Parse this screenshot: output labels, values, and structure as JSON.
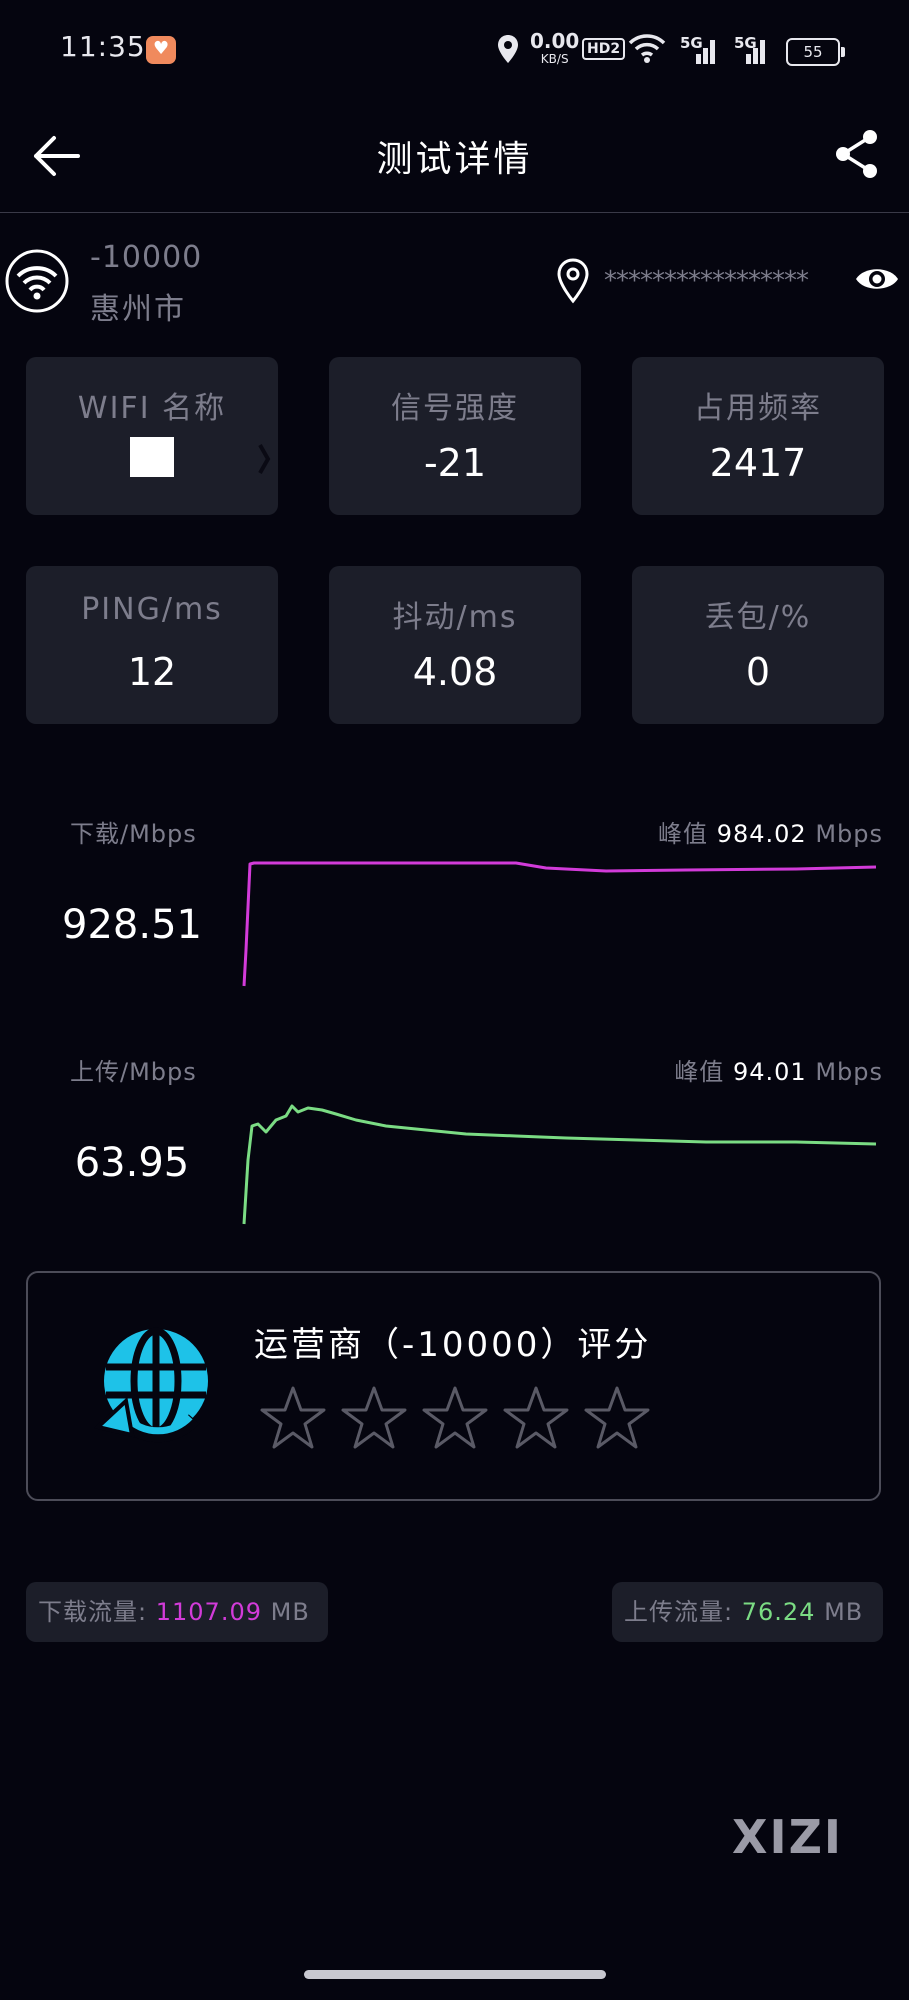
{
  "status_bar": {
    "time": "11:35",
    "net_speed": "0.00",
    "net_unit": "KB/S",
    "hd_badge": "HD2",
    "signal_1": "5G",
    "signal_2": "5G",
    "battery": "55"
  },
  "header": {
    "title": "测试详情",
    "back_icon": "arrow-left-icon",
    "share_icon": "share-icon"
  },
  "info": {
    "isp": "-10000",
    "city": "惠州市",
    "masked_address": "*****************",
    "wifi_icon": "wifi-icon",
    "location_icon": "location-pin-icon",
    "reveal_icon": "eye-icon"
  },
  "stats": [
    {
      "label": "WIFI 名称",
      "value": ""
    },
    {
      "label": "信号强度",
      "value": "-21"
    },
    {
      "label": "占用频率",
      "value": "2417"
    },
    {
      "label": "PING/ms",
      "value": "12"
    },
    {
      "label": "抖动/ms",
      "value": "4.08"
    },
    {
      "label": "丢包/%",
      "value": "0"
    }
  ],
  "download": {
    "label": "下载/Mbps",
    "peak_label": "峰值",
    "peak_value": "984.02",
    "peak_unit": "Mbps",
    "value": "928.51",
    "color": "#d23bd9"
  },
  "upload": {
    "label": "上传/Mbps",
    "peak_label": "峰值",
    "peak_value": "94.01",
    "peak_unit": "Mbps",
    "value": "63.95",
    "color": "#7bdc84"
  },
  "rating": {
    "title": "运营商（-10000）评分",
    "stars": 5,
    "filled": 0,
    "icon": "globe-refresh-icon",
    "icon_color": "#1ec2e8"
  },
  "traffic": {
    "download_label": "下载流量:",
    "download_value": "1107.09",
    "download_unit": "MB",
    "upload_label": "上传流量:",
    "upload_value": "76.24",
    "upload_unit": "MB"
  },
  "watermark": "XIZI"
}
